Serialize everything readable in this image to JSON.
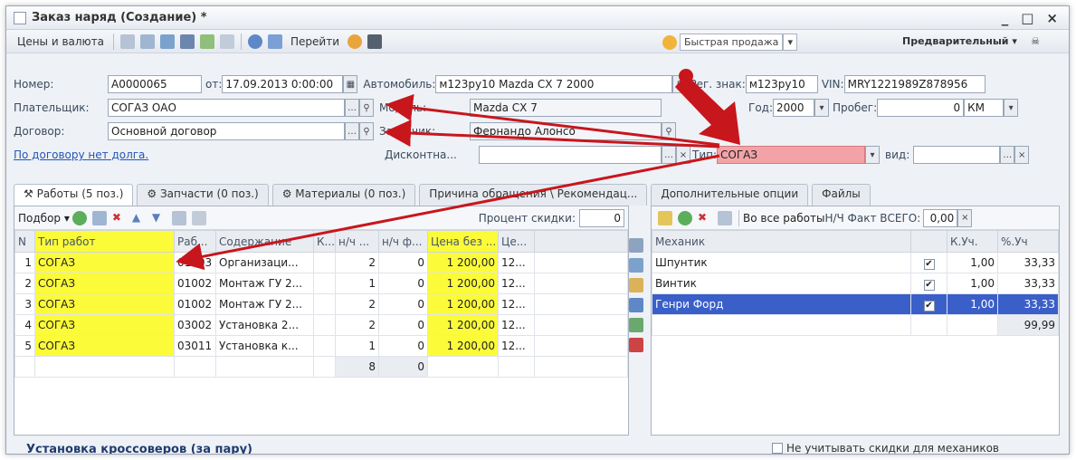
{
  "window": {
    "title": "Заказ наряд (Создание) *",
    "controls": [
      "_",
      "□",
      "×"
    ]
  },
  "toolbar": {
    "prices_label": "Цены и валюта",
    "goto_label": "Перейти",
    "fast_sale_label": "Быстрая продажа",
    "status_label": "Предварительный"
  },
  "form": {
    "number_label": "Номер:",
    "number_value": "А0000065",
    "from_label": "от:",
    "date_value": "17.09.2013 0:00:00",
    "car_label": "Автомобиль:",
    "car_value": "м123ру10 Mazda CX 7 2000",
    "reg_label": "Рег. знак:",
    "reg_value": "м123ру10",
    "vin_label": "VIN:",
    "vin_value": "MRY1221989Z878956",
    "payer_label": "Плательщик:",
    "payer_value": "СОГАЗ ОАО",
    "model_label": "Модель:",
    "model_value": "Mazda CX 7",
    "year_label": "Год:",
    "year_value": "2000",
    "mileage_label": "Пробег:",
    "mileage_value": "0",
    "mileage_unit": "КМ",
    "contract_label": "Договор:",
    "contract_value": "Основной договор",
    "customer_label": "Заказчик:",
    "customer_value": "Фернандо Алонсо",
    "debt_link": "По договору нет долга.",
    "discount_label": "Дисконтна...",
    "type_label": "Тип:",
    "type_value": "СОГАЗ",
    "kind_label": "вид:"
  },
  "tabs": [
    {
      "label": "Работы (5 поз.)"
    },
    {
      "label": "Запчасти (0 поз.)"
    },
    {
      "label": "Материалы (0 поз.)"
    },
    {
      "label": "Причина обращения \\ Рекомендац..."
    },
    {
      "label": "Дополнительные опции"
    },
    {
      "label": "Файлы"
    }
  ],
  "works": {
    "pick_label": "Подбор",
    "discount_label": "Процент скидки:",
    "discount_value": "0",
    "columns": [
      "N",
      "Тип работ",
      "Раб...",
      "Содержание",
      "К...",
      "н/ч ...",
      "н/ч ф...",
      "Цена без ...",
      "Це..."
    ],
    "rows": [
      [
        "1",
        "СОГАЗ",
        "01003",
        "Организаци...",
        "",
        "2",
        "0",
        "1 200,00",
        "12..."
      ],
      [
        "2",
        "СОГАЗ",
        "01002",
        "Монтаж ГУ 2...",
        "",
        "1",
        "0",
        "1 200,00",
        "12..."
      ],
      [
        "3",
        "СОГАЗ",
        "01002",
        "Монтаж ГУ 2...",
        "",
        "2",
        "0",
        "1 200,00",
        "12..."
      ],
      [
        "4",
        "СОГАЗ",
        "03002",
        "Установка 2...",
        "",
        "2",
        "0",
        "1 200,00",
        "12..."
      ],
      [
        "5",
        "СОГАЗ",
        "03011",
        "Установка к...",
        "",
        "1",
        "0",
        "1 200,00",
        "12..."
      ]
    ],
    "total_nh": "8",
    "total_nhf": "0"
  },
  "mechanics": {
    "all_works_label": "Во все работы",
    "fact_label": "Н/Ч Факт ВСЕГО:",
    "fact_value": "0,00",
    "columns": [
      "Механик",
      "",
      "К.Уч.",
      "%.Уч"
    ],
    "rows": [
      [
        "Шпунтик",
        "✔",
        "1,00",
        "33,33"
      ],
      [
        "Винтик",
        "✔",
        "1,00",
        "33,33"
      ],
      [
        "Генри Форд",
        "✔",
        "1,00",
        "33,33"
      ]
    ],
    "total_percent": "99,99"
  },
  "footer": {
    "work_title": "Установка кроссоверов (за пару)",
    "no_discount_label": "Не учитывать скидки для механиков"
  }
}
